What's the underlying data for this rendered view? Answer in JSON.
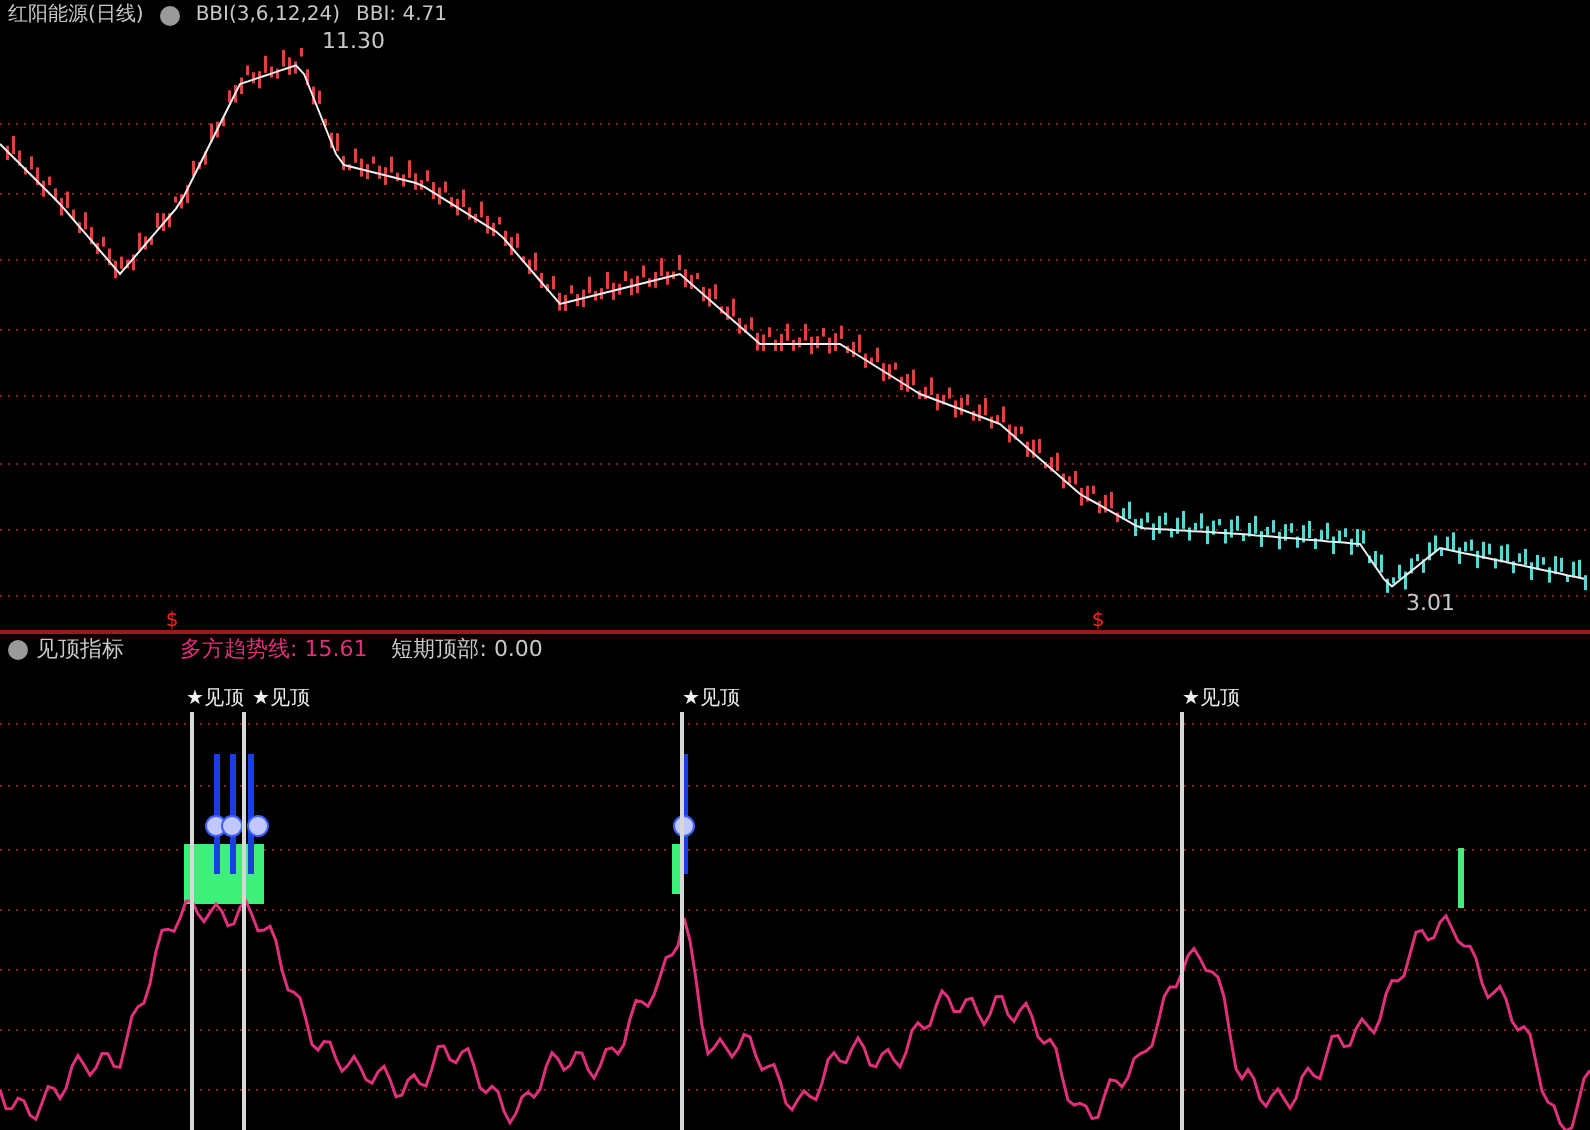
{
  "chart_header": {
    "title": "红阳能源(日线)",
    "indicator": "BBI(3,6,12,24)",
    "reading": "BBI: 4.71"
  },
  "price_labels": {
    "high": "11.30",
    "low": "3.01"
  },
  "axis_marks": [
    "$",
    "$"
  ],
  "indicator_panel": {
    "name": "见顶指标",
    "expanded": true,
    "series": [
      {
        "label": "多方趋势线:",
        "value": "15.61",
        "color": "#e0307a"
      },
      {
        "label": "短期顶部:",
        "value": "0.00",
        "color": "#c8c8c8"
      }
    ]
  },
  "signals": [
    {
      "label": "★见顶"
    },
    {
      "label": "★见顶"
    },
    {
      "label": "★见顶"
    },
    {
      "label": "★见顶"
    }
  ]
}
